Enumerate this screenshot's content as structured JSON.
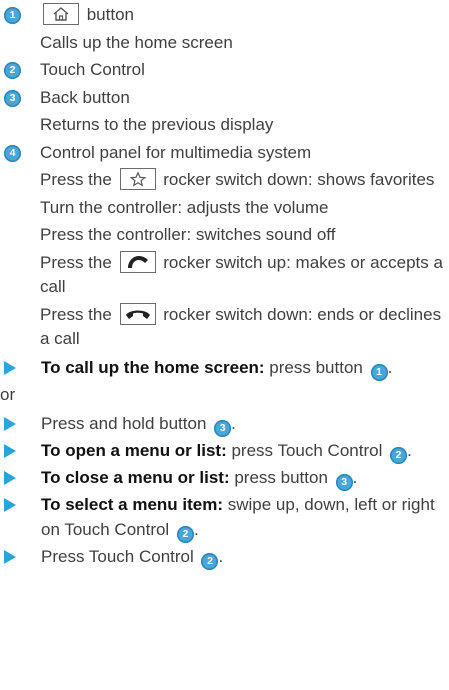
{
  "legend": [
    {
      "num": "1",
      "lines_pre": "",
      "key": "home-key",
      "lines_post": " button",
      "desc": [
        "Calls up the home screen"
      ]
    },
    {
      "num": "2",
      "title": "Touch Control",
      "desc": []
    },
    {
      "num": "3",
      "title": "Back button",
      "desc": [
        "Returns to the previous display"
      ]
    },
    {
      "num": "4",
      "title": "Control panel for multimedia system",
      "desc_rich": [
        {
          "pre": "Press the ",
          "key": "star-key",
          "post": " rocker switch down: shows favorites"
        },
        {
          "pre": "Turn the controller: adjusts the volume"
        },
        {
          "pre": "Press the controller: switches sound off"
        },
        {
          "pre": "Press the ",
          "key": "phone-up-key",
          "post": " rocker switch up: makes or accepts a call"
        },
        {
          "pre": "Press the ",
          "key": "phone-down-key",
          "post": " rocker switch down: ends or declines a call"
        }
      ]
    }
  ],
  "steps": [
    {
      "bold": "To call up the home screen:",
      "text": " press button ",
      "ref": "1",
      "tail": "."
    },
    {
      "or": "or"
    },
    {
      "bold": "",
      "text": "Press and hold button ",
      "ref": "3",
      "tail": "."
    },
    {
      "bold": "To open a menu or list:",
      "text": " press Touch Control ",
      "ref": "2",
      "tail": "."
    },
    {
      "bold": "To close a menu or list:",
      "text": " press button ",
      "ref": "3",
      "tail": "."
    },
    {
      "bold": "To select a menu item:",
      "text": " swipe up, down, left or right on Touch Control ",
      "ref": "2",
      "tail": "."
    },
    {
      "bold": "",
      "text": "Press Touch Control ",
      "ref": "2",
      "tail": "."
    }
  ],
  "colors": {
    "accent": "#49a6d8",
    "arrow": "#2aa3da"
  }
}
